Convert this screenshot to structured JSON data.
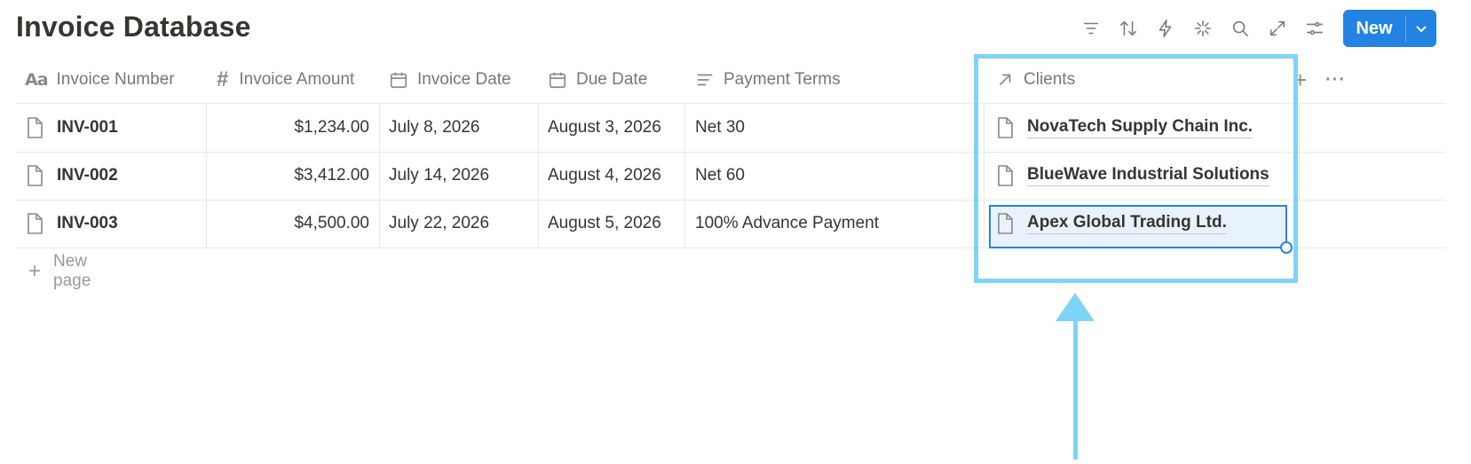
{
  "page": {
    "title": "Invoice Database"
  },
  "toolbar": {
    "icons": [
      "filter-icon",
      "sort-icon",
      "lightning-icon",
      "sparkle-icon",
      "search-icon",
      "expand-icon",
      "settings-sliders-icon"
    ],
    "new_label": "New"
  },
  "columns": [
    {
      "label": "Invoice Number",
      "icon": "text-aa-icon"
    },
    {
      "label": "Invoice Amount",
      "icon": "hash-icon"
    },
    {
      "label": "Invoice Date",
      "icon": "calendar-icon"
    },
    {
      "label": "Due Date",
      "icon": "calendar-icon"
    },
    {
      "label": "Payment Terms",
      "icon": "text-lines-icon"
    },
    {
      "label": "Clients",
      "icon": "relation-arrow-icon"
    }
  ],
  "header_actions": {
    "add": "+",
    "more": "···"
  },
  "rows": [
    {
      "number": "INV-001",
      "amount": "$1,234.00",
      "invoice_date": "July 8, 2026",
      "due_date": "August 3, 2026",
      "terms": "Net 30",
      "client": "NovaTech Supply Chain Inc."
    },
    {
      "number": "INV-002",
      "amount": "$3,412.00",
      "invoice_date": "July 14, 2026",
      "due_date": "August 4, 2026",
      "terms": "Net 60",
      "client": "BlueWave Industrial Solutions"
    },
    {
      "number": "INV-003",
      "amount": "$4,500.00",
      "invoice_date": "July 22, 2026",
      "due_date": "August 5, 2026",
      "terms": "100% Advance Payment",
      "client": "Apex Global Trading Ltd."
    }
  ],
  "new_page_label": "New page",
  "colors": {
    "accent": "#2383e2",
    "highlight": "#7fd3f7",
    "text": "#37352f",
    "muted": "#787774"
  }
}
